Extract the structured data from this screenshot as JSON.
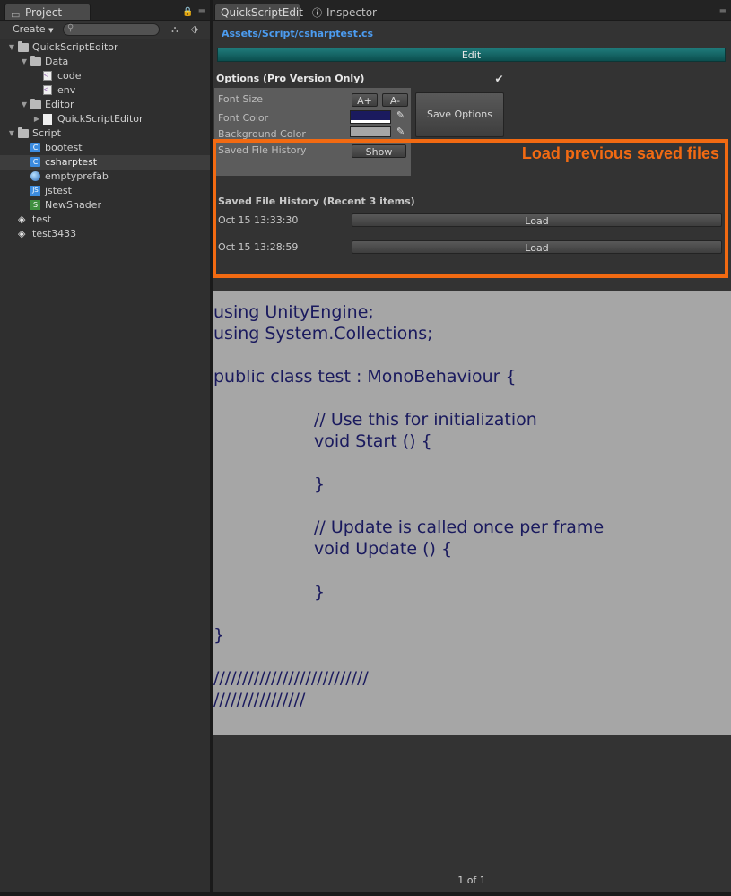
{
  "project": {
    "tab_label": "Project",
    "create_label": "Create",
    "search_placeholder": "",
    "tree": [
      {
        "label": "QuickScriptEditor",
        "icon": "folder-icon",
        "level": 0,
        "expanded": true
      },
      {
        "label": "Data",
        "icon": "folder-icon",
        "level": 1,
        "expanded": true
      },
      {
        "label": "code",
        "icon": "vs-file-icon",
        "level": 2
      },
      {
        "label": "env",
        "icon": "vs-file-icon",
        "level": 2
      },
      {
        "label": "Editor",
        "icon": "folder-icon",
        "level": 1,
        "expanded": true
      },
      {
        "label": "QuickScriptEditor",
        "icon": "document-icon",
        "level": 2,
        "collapsed": true
      },
      {
        "label": "Script",
        "icon": "folder-icon",
        "level": 0,
        "expanded": true
      },
      {
        "label": "bootest",
        "icon": "csharp-icon",
        "level": 1
      },
      {
        "label": "csharptest",
        "icon": "csharp-icon",
        "level": 1,
        "selected": true
      },
      {
        "label": "emptyprefab",
        "icon": "prefab-icon",
        "level": 1
      },
      {
        "label": "jstest",
        "icon": "js-icon",
        "level": 1
      },
      {
        "label": "NewShader",
        "icon": "shader-icon",
        "level": 1
      },
      {
        "label": "test",
        "icon": "unity-scene-icon",
        "level": 0
      },
      {
        "label": "test3433",
        "icon": "unity-scene-icon",
        "level": 0
      }
    ]
  },
  "editor": {
    "tabs": [
      {
        "label": "QuickScriptEdit",
        "active": true
      },
      {
        "label": "Inspector",
        "active": false
      }
    ],
    "file_path": "Assets/Script/csharptest.cs",
    "edit_label": "Edit",
    "options_title": "Options (Pro Version Only)",
    "options_checked": true,
    "font_size_label": "Font Size",
    "font_plus": "A+",
    "font_minus": "A-",
    "font_color_label": "Font Color",
    "font_color": "#1a1a5e",
    "background_color_label": "Background Color",
    "background_color": "#a6a6a6",
    "saved_history_label": "Saved File History",
    "show_label": "Show",
    "save_options_label": "Save Options",
    "annotation": "Load previous saved files",
    "history_title": "Saved File History (Recent 3 items)",
    "history": [
      {
        "date": "Oct 15 13:33:30",
        "button": "Load"
      },
      {
        "date": "Oct 15 13:28:59",
        "button": "Load"
      }
    ],
    "code_lines": [
      "using UnityEngine;",
      "using System.Collections;",
      "",
      "public class test : MonoBehaviour {",
      "",
      "\t\t// Use this for initialization",
      "\t\tvoid Start () {",
      "",
      "\t\t}",
      "",
      "\t\t// Update is called once per frame",
      "\t\tvoid Update () {",
      "",
      "\t\t}",
      "",
      "}",
      "",
      "///////////////////////////",
      "////////////////"
    ],
    "pager": "1 of 1"
  }
}
